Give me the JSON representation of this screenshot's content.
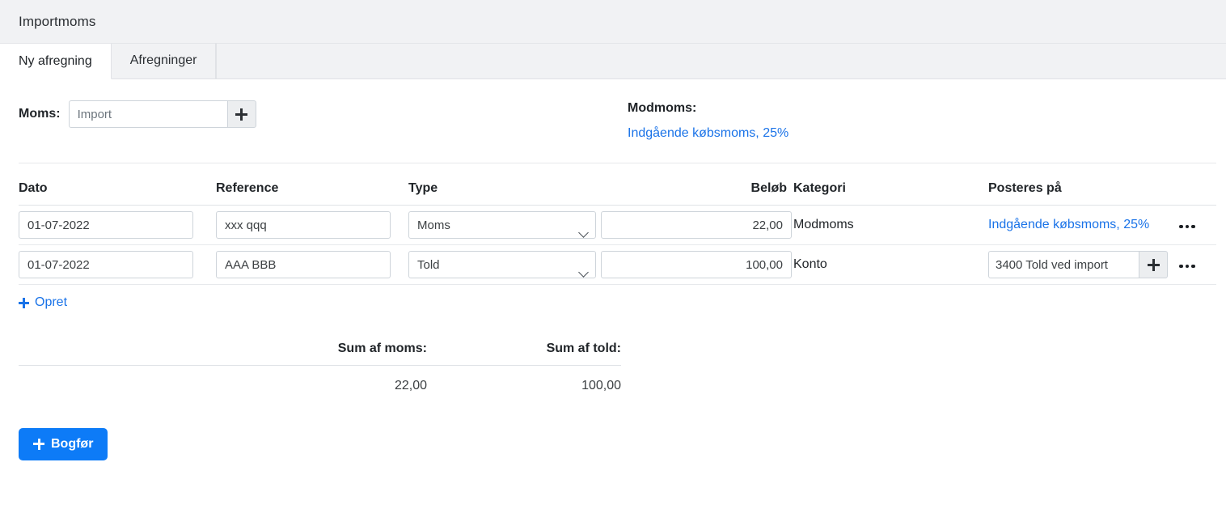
{
  "window": {
    "title": "Importmoms"
  },
  "tabs": [
    {
      "label": "Ny afregning",
      "active": true
    },
    {
      "label": "Afregninger",
      "active": false
    }
  ],
  "form": {
    "moms_label": "Moms:",
    "moms_value": "Import",
    "moms_placeholder": "Import",
    "moms_add_icon": "plus-icon",
    "modmoms_label": "Modmoms:",
    "modmoms_value": "Indgående købsmoms, 25%"
  },
  "table": {
    "headers": {
      "dato": "Dato",
      "reference": "Reference",
      "type": "Type",
      "belob": "Beløb",
      "kategori": "Kategori",
      "posteres_paa": "Posteres på"
    },
    "rows": [
      {
        "dato": "01-07-2022",
        "reference": "xxx qqq",
        "type": "Moms",
        "type_options": [
          "Moms",
          "Told"
        ],
        "belob": "22,00",
        "kategori": "Modmoms",
        "posteres_paa": "Indgående købsmoms, 25%",
        "posteres_paa_kind": "link",
        "menu_icon": "ellipsis-icon"
      },
      {
        "dato": "01-07-2022",
        "reference": "AAA BBB",
        "type": "Told",
        "type_options": [
          "Moms",
          "Told"
        ],
        "belob": "100,00",
        "kategori": "Konto",
        "posteres_paa": "3400 Told ved import",
        "posteres_paa_kind": "input",
        "posteres_add_icon": "plus-icon",
        "menu_icon": "ellipsis-icon"
      }
    ],
    "create_label": "Opret",
    "create_icon": "plus-icon"
  },
  "summary": {
    "sum_moms_label": "Sum af moms:",
    "sum_told_label": "Sum af told:",
    "sum_moms_value": "22,00",
    "sum_told_value": "100,00"
  },
  "footer": {
    "submit_label": "Bogfør",
    "submit_icon": "plus-icon"
  },
  "colors": {
    "link": "#1a73e8",
    "primary_button": "#0d7bf7",
    "header_bg": "#f1f2f4",
    "border": "#ced4da"
  }
}
